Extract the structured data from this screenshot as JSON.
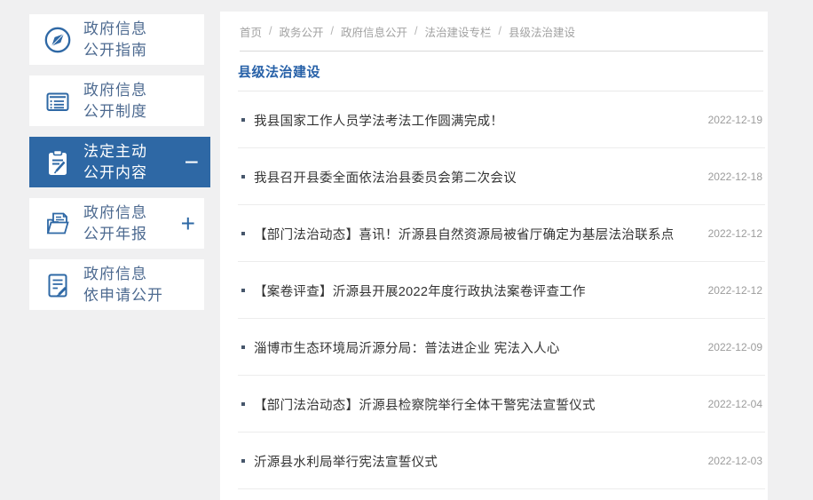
{
  "page": {
    "background_color": "#f0f0f1",
    "accent_color": "#2e68a5",
    "title_color": "#2761a8"
  },
  "sidebar": {
    "items": [
      {
        "line1": "政府信息",
        "line2": "公开指南",
        "icon": "compass-icon",
        "active": false,
        "toggle": ""
      },
      {
        "line1": "政府信息",
        "line2": "公开制度",
        "icon": "list-document-icon",
        "active": false,
        "toggle": ""
      },
      {
        "line1": "法定主动",
        "line2": "公开内容",
        "icon": "clipboard-pen-icon",
        "active": true,
        "toggle": "−"
      },
      {
        "line1": "政府信息",
        "line2": "公开年报",
        "icon": "folder-document-icon",
        "active": false,
        "toggle": "+"
      },
      {
        "line1": "政府信息",
        "line2": "依申请公开",
        "icon": "document-pen-icon",
        "active": false,
        "toggle": ""
      }
    ]
  },
  "breadcrumb": {
    "separator": "/",
    "items": [
      "首页",
      "政务公开",
      "政府信息公开",
      "法治建设专栏",
      "县级法治建设"
    ]
  },
  "main": {
    "title": "县级法治建设",
    "articles": [
      {
        "title": "我县国家工作人员学法考法工作圆满完成！",
        "date": "2022-12-19"
      },
      {
        "title": "我县召开县委全面依法治县委员会第二次会议",
        "date": "2022-12-18"
      },
      {
        "title": "【部门法治动态】喜讯！沂源县自然资源局被省厅确定为基层法治联系点",
        "date": "2022-12-12"
      },
      {
        "title": "【案卷评查】沂源县开展2022年度行政执法案卷评查工作",
        "date": "2022-12-12"
      },
      {
        "title": "淄博市生态环境局沂源分局：普法进企业 宪法入人心",
        "date": "2022-12-09"
      },
      {
        "title": "【部门法治动态】沂源县检察院举行全体干警宪法宣誓仪式",
        "date": "2022-12-04"
      },
      {
        "title": "沂源县水利局举行宪法宣誓仪式",
        "date": "2022-12-03"
      }
    ]
  }
}
